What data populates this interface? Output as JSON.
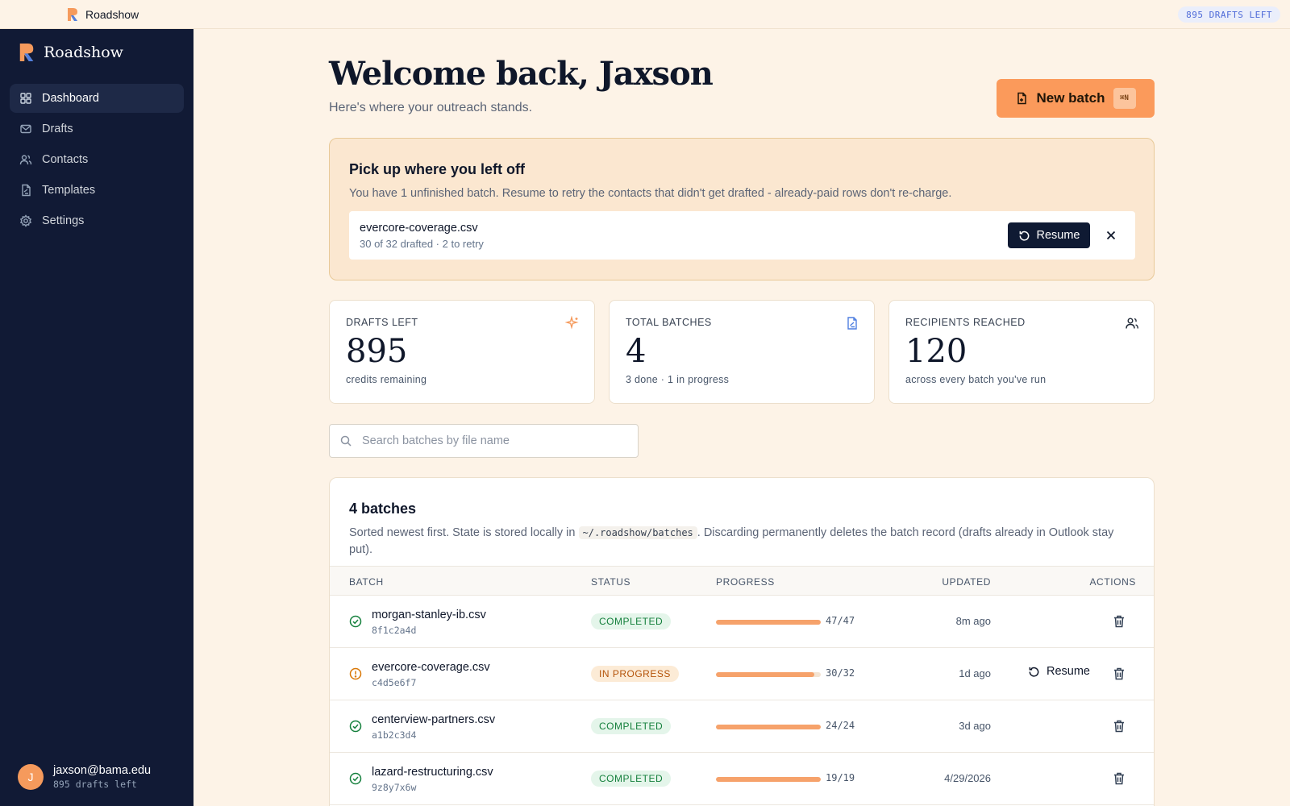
{
  "app": {
    "name": "Roadshow",
    "drafts_pill": "895 DRAFTS LEFT"
  },
  "sidebar": {
    "brand": "Roadshow",
    "items": [
      {
        "label": "Dashboard",
        "icon": "grid-icon",
        "active": true
      },
      {
        "label": "Drafts",
        "icon": "mail-icon",
        "active": false
      },
      {
        "label": "Contacts",
        "icon": "users-icon",
        "active": false
      },
      {
        "label": "Templates",
        "icon": "file-icon",
        "active": false
      },
      {
        "label": "Settings",
        "icon": "gear-icon",
        "active": false
      }
    ],
    "user": {
      "initial": "J",
      "email": "jaxson@bama.edu",
      "sub": "895 drafts left"
    }
  },
  "header": {
    "title": "Welcome back, Jaxson",
    "subtitle": "Here's where your outreach stands.",
    "new_batch_label": "New batch",
    "shortcut": "⌘N"
  },
  "resume_card": {
    "title": "Pick up where you left off",
    "description": "You have 1 unfinished batch. Resume to retry the contacts that didn't get drafted - already-paid rows don't re-charge.",
    "file": "evercore-coverage.csv",
    "meta": "30 of 32 drafted · 2 to retry",
    "resume_label": "Resume"
  },
  "stats": [
    {
      "label": "DRAFTS LEFT",
      "value": "895",
      "sub": "credits remaining",
      "icon": "sparkle-icon"
    },
    {
      "label": "TOTAL BATCHES",
      "value": "4",
      "sub": "3 done · 1 in progress",
      "icon": "file-icon"
    },
    {
      "label": "RECIPIENTS REACHED",
      "value": "120",
      "sub": "across every batch you've run",
      "icon": "users-icon"
    }
  ],
  "search": {
    "placeholder": "Search batches by file name",
    "value": ""
  },
  "batches": {
    "title": "4 batches",
    "desc_before": "Sorted newest first. State is stored locally in ",
    "desc_code": "~/.roadshow/batches",
    "desc_after": ". Discarding permanently deletes the batch record (drafts already in Outlook stay put).",
    "columns": [
      "BATCH",
      "STATUS",
      "PROGRESS",
      "UPDATED",
      "ACTIONS"
    ],
    "rows": [
      {
        "file": "morgan-stanley-ib.csv",
        "id": "8f1c2a4d",
        "status": "COMPLETED",
        "state": "completed",
        "done": 47,
        "total": 47,
        "progress": "47/47",
        "updated": "8m ago",
        "action": ""
      },
      {
        "file": "evercore-coverage.csv",
        "id": "c4d5e6f7",
        "status": "IN PROGRESS",
        "state": "in-progress",
        "done": 30,
        "total": 32,
        "progress": "30/32",
        "updated": "1d ago",
        "action": "Resume"
      },
      {
        "file": "centerview-partners.csv",
        "id": "a1b2c3d4",
        "status": "COMPLETED",
        "state": "completed",
        "done": 24,
        "total": 24,
        "progress": "24/24",
        "updated": "3d ago",
        "action": ""
      },
      {
        "file": "lazard-restructuring.csv",
        "id": "9z8y7x6w",
        "status": "COMPLETED",
        "state": "completed",
        "done": 19,
        "total": 19,
        "progress": "19/19",
        "updated": "4/29/2026",
        "action": ""
      }
    ]
  },
  "colors": {
    "accent": "#fb9a5b",
    "sidebar": "#111a35",
    "completed": "#15803d",
    "in_progress": "#b45309"
  }
}
